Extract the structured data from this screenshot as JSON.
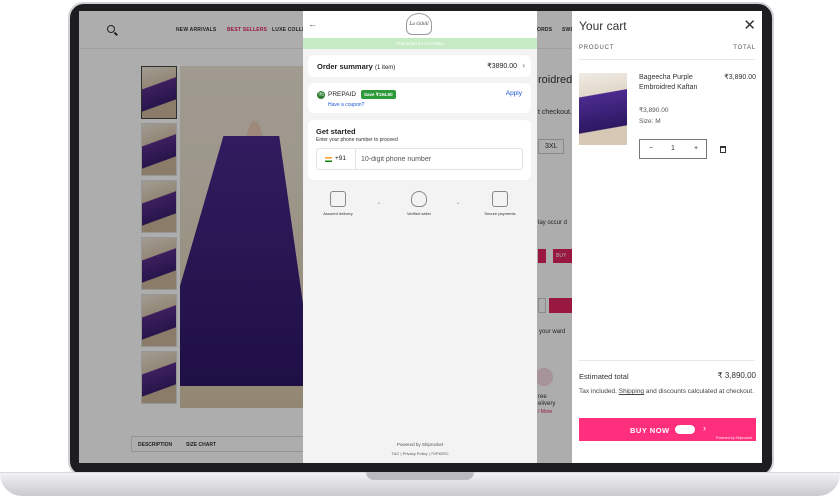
{
  "store": {
    "nav": [
      "NEW ARRIVALS",
      "BEST SELLERS",
      "LUXE COLLE",
      "ORDS",
      "SWD"
    ],
    "fragments": {
      "title_frag": "roidred",
      "checkout_frag": "t checkout.",
      "size_frag": "3XL",
      "occur_frag": "lay occur d",
      "wardrobe_frag": "your ward",
      "delivery_frag1": "ree",
      "delivery_frag2": "elivery",
      "more_frag": "/ More",
      "buy_frag": "BUY"
    },
    "tabs": [
      "DESCRIPTION",
      "SIZE CHART"
    ]
  },
  "checkout": {
    "back": "←",
    "logo_text": "La Gibili",
    "promo": "Preloaded for LA GIBILI",
    "order_summary": {
      "title": "Order summary",
      "items": "(1 item)",
      "price": "₹3890.00"
    },
    "prepaid": {
      "label": "PREPAID",
      "badge": "Save ₹194.50",
      "apply": "Apply",
      "coupon": "Have a coupon?"
    },
    "get_started": {
      "title": "Get started",
      "subtitle": "Enter your phone number to proceed",
      "code": "+91",
      "placeholder": "10-digit phone number"
    },
    "trust": [
      "Assured delivery",
      "Verified seller",
      "Secure payments"
    ],
    "powered": "Powered by Shiprocket",
    "footer": "T&C | Privacy Policy | 7OPt2lSC"
  },
  "cart": {
    "title": "Your cart",
    "col_product": "PRODUCT",
    "col_total": "TOTAL",
    "item": {
      "name": "Bageecha Purple Embroidred Kaftan",
      "price": "₹3,890.00",
      "unit_price": "₹3,890.00",
      "size": "Size: M",
      "qty": "1"
    },
    "estimated_label": "Estimated total",
    "estimated_value": "₹ 3,890.00",
    "tax_pre": "Tax included. ",
    "tax_link": "Shipping",
    "tax_post": " and discounts calculated at checkout.",
    "buy_now": "BUY NOW",
    "buy_small": "Powered by Shiprocket"
  },
  "colors": {
    "accent": "#ff2f7e",
    "link": "#1a56d6",
    "success": "#2e9b3a"
  }
}
